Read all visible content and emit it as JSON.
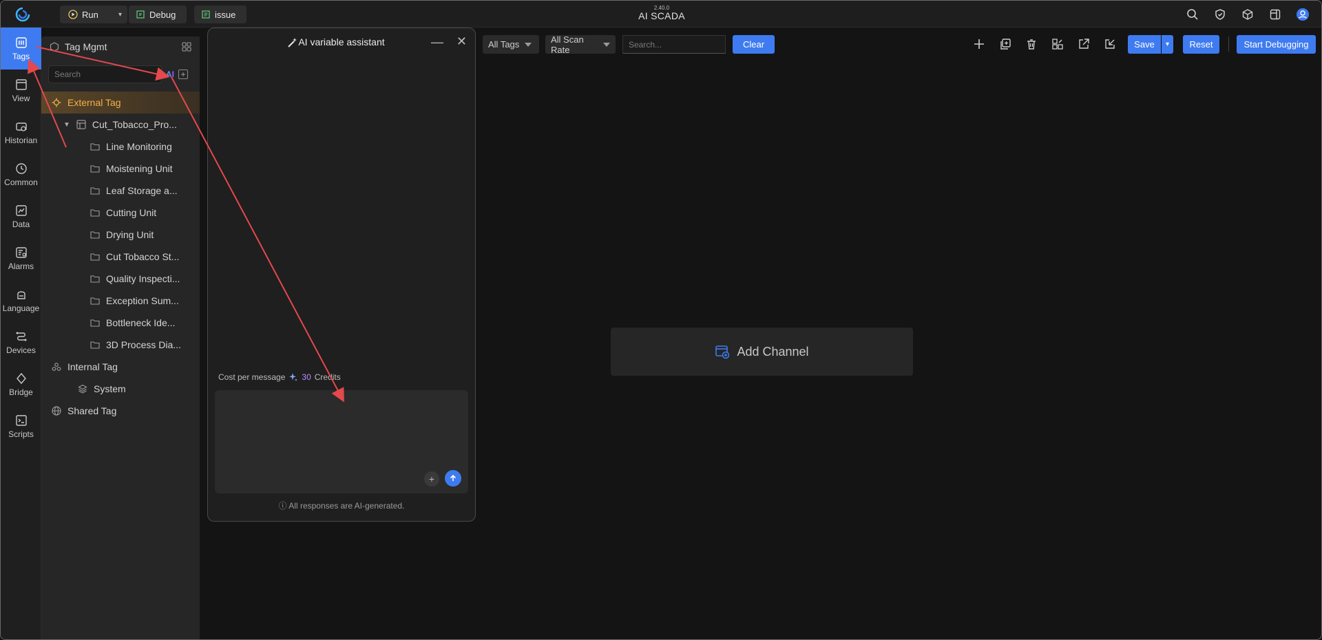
{
  "app": {
    "version": "2.40.0",
    "title": "AI SCADA"
  },
  "toolbar": {
    "run_label": "Run",
    "debug_label": "Debug",
    "issue_label": "issue"
  },
  "rail": {
    "items": [
      {
        "label": "Tags",
        "icon": "tags-icon",
        "active": true
      },
      {
        "label": "View",
        "icon": "view-icon"
      },
      {
        "label": "Historian",
        "icon": "historian-icon"
      },
      {
        "label": "Common",
        "icon": "common-icon"
      },
      {
        "label": "Data",
        "icon": "data-icon"
      },
      {
        "label": "Alarms",
        "icon": "alarms-icon"
      },
      {
        "label": "Language",
        "icon": "language-icon"
      },
      {
        "label": "Devices",
        "icon": "devices-icon"
      },
      {
        "label": "Bridge",
        "icon": "bridge-icon"
      },
      {
        "label": "Scripts",
        "icon": "scripts-icon"
      }
    ]
  },
  "tree": {
    "header": "Tag Mgmt",
    "search_placeholder": "Search",
    "ai_badge": "AI",
    "nodes": [
      {
        "label": "External Tag",
        "level": 0,
        "type": "external",
        "selected": true
      },
      {
        "label": "Cut_Tobacco_Pro...",
        "level": 1,
        "type": "group",
        "expanded": true
      },
      {
        "label": "Line Monitoring",
        "level": 2,
        "type": "folder"
      },
      {
        "label": "Moistening Unit",
        "level": 2,
        "type": "folder"
      },
      {
        "label": "Leaf Storage a...",
        "level": 2,
        "type": "folder"
      },
      {
        "label": "Cutting Unit",
        "level": 2,
        "type": "folder"
      },
      {
        "label": "Drying Unit",
        "level": 2,
        "type": "folder"
      },
      {
        "label": "Cut Tobacco St...",
        "level": 2,
        "type": "folder"
      },
      {
        "label": "Quality Inspecti...",
        "level": 2,
        "type": "folder"
      },
      {
        "label": "Exception Sum...",
        "level": 2,
        "type": "folder"
      },
      {
        "label": "Bottleneck Ide...",
        "level": 2,
        "type": "folder"
      },
      {
        "label": "3D Process Dia...",
        "level": 2,
        "type": "folder"
      },
      {
        "label": "Internal Tag",
        "level": 0,
        "type": "internal"
      },
      {
        "label": "System",
        "level": 1,
        "type": "system"
      },
      {
        "label": "Shared Tag",
        "level": 0,
        "type": "shared"
      }
    ]
  },
  "ai_panel": {
    "title": "AI variable assistant",
    "cost_label": "Cost per message",
    "cost_value": "30",
    "cost_unit": "Credits",
    "input_value": "",
    "footer": "All responses are AI-generated."
  },
  "filters": {
    "tags_label": "All Tags",
    "scan_rate_label": "All Scan Rate",
    "search_placeholder": "Search...",
    "clear_label": "Clear"
  },
  "actions": {
    "save_label": "Save",
    "reset_label": "Reset",
    "start_debugging_label": "Start Debugging"
  },
  "main": {
    "add_channel_label": "Add Channel"
  },
  "colors": {
    "accent": "#3f7bf0",
    "selected_text": "#f0b24a",
    "annotation": "#e5484d"
  }
}
